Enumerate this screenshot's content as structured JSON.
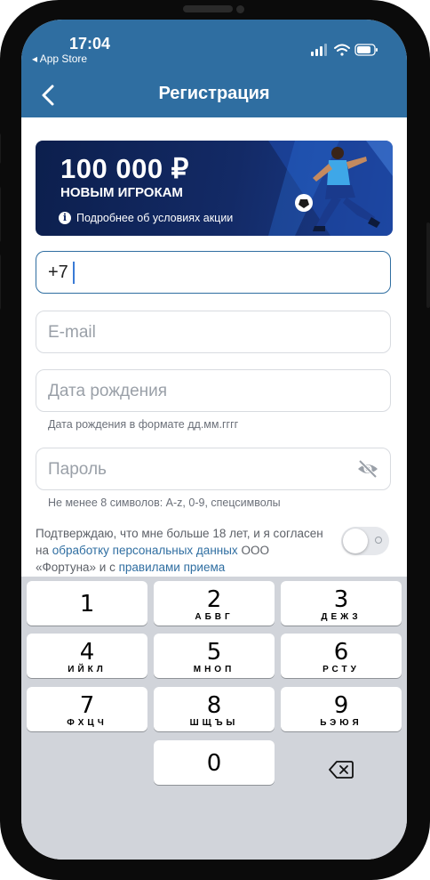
{
  "status_bar": {
    "time": "17:04",
    "back_to_app": "◂ App Store"
  },
  "nav": {
    "title": "Регистрация",
    "back_icon": "chevron-left-icon"
  },
  "banner": {
    "amount": "100 000 ₽",
    "subtitle": "НОВЫМ ИГРОКАМ",
    "info_icon_glyph": "i",
    "info_text": "Подробнее об условиях акции"
  },
  "form": {
    "phone_value": "+7",
    "email_placeholder": "E-mail",
    "birthdate_placeholder": "Дата рождения",
    "birthdate_hint": "Дата рождения в формате дд.мм.гггг",
    "password_placeholder": "Пароль",
    "password_hint": "Не менее 8 символов: A-z, 0-9, спецсимволы"
  },
  "consent": {
    "text_1": "Подтверждаю, что мне больше 18 лет, и я согласен на ",
    "link_1": "обработку персональных данных",
    "text_2": " ООО «Фортуна» и с ",
    "link_2": "правилами приема",
    "toggle_on": false
  },
  "keyboard": {
    "keys": [
      {
        "digit": "1",
        "letters": ""
      },
      {
        "digit": "2",
        "letters": "АБВГ"
      },
      {
        "digit": "3",
        "letters": "ДЕЖЗ"
      },
      {
        "digit": "4",
        "letters": "ИЙКЛ"
      },
      {
        "digit": "5",
        "letters": "МНОП"
      },
      {
        "digit": "6",
        "letters": "РСТУ"
      },
      {
        "digit": "7",
        "letters": "ФХЦЧ"
      },
      {
        "digit": "8",
        "letters": "ШЩЪЫ"
      },
      {
        "digit": "9",
        "letters": "ЬЭЮЯ"
      },
      {
        "digit": "0",
        "letters": ""
      }
    ],
    "backspace_icon": "backspace-icon"
  },
  "colors": {
    "brand_blue": "#2f6ea1",
    "banner_dark": "#132a66",
    "link": "#2f6ea1"
  }
}
